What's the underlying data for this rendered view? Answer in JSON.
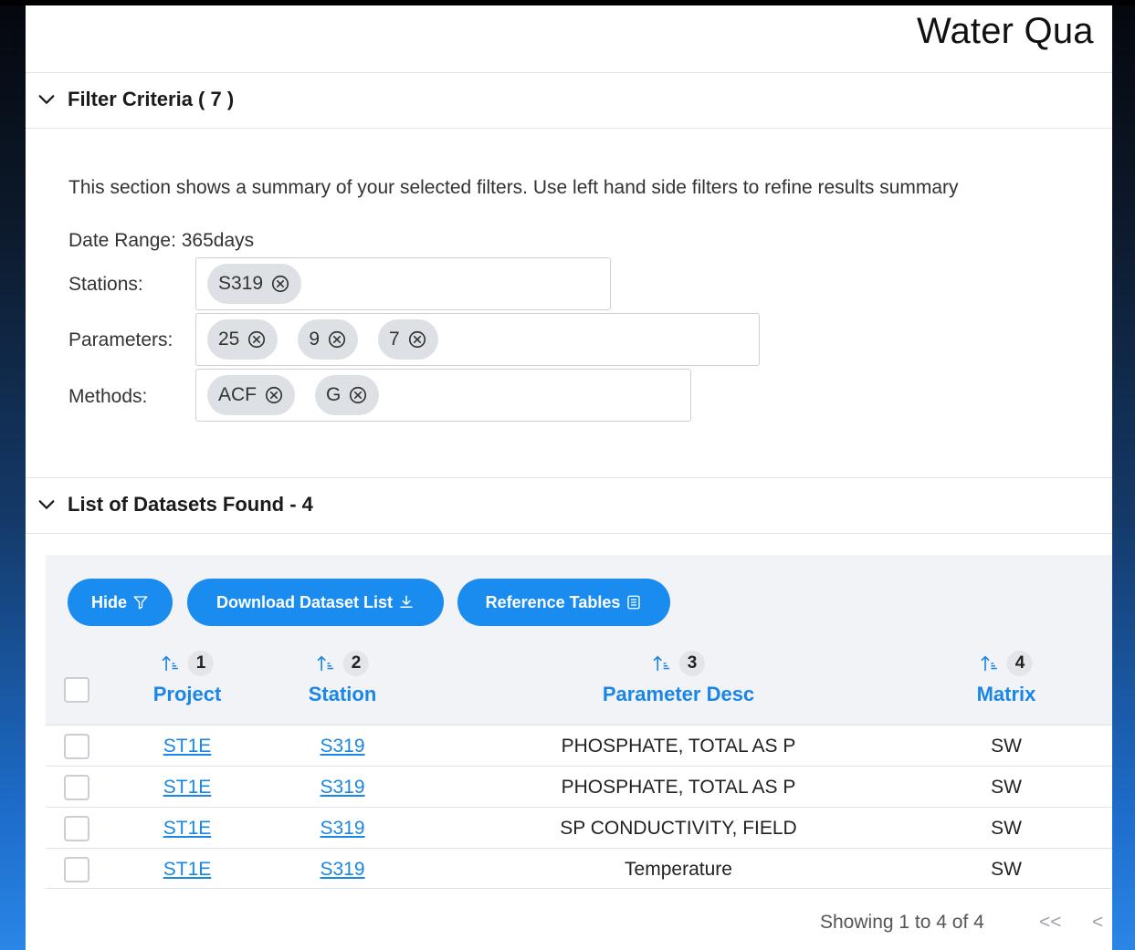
{
  "page": {
    "title": "Water Qua"
  },
  "filter_section": {
    "title": "Filter Criteria ( 7 )",
    "summary_text": "This section shows a summary of your selected filters. Use left hand side filters to refine results summary",
    "date_range": "Date Range: 365days",
    "stations": {
      "label": "Stations:",
      "chips": [
        "S319"
      ]
    },
    "parameters": {
      "label": "Parameters:",
      "chips": [
        "25",
        "9",
        "7"
      ]
    },
    "methods": {
      "label": "Methods:",
      "chips": [
        "ACF",
        "G"
      ]
    }
  },
  "datasets_section": {
    "title": "List of Datasets Found - 4",
    "buttons": {
      "hide": "Hide",
      "download": "Download Dataset List",
      "reference": "Reference Tables"
    },
    "columns": [
      {
        "order": "1",
        "label": "Project"
      },
      {
        "order": "2",
        "label": "Station"
      },
      {
        "order": "3",
        "label": "Parameter Desc"
      },
      {
        "order": "4",
        "label": "Matrix"
      }
    ],
    "rows": [
      {
        "project": "ST1E",
        "station": "S319",
        "parameter": "PHOSPHATE, TOTAL AS P",
        "matrix": "SW"
      },
      {
        "project": "ST1E",
        "station": "S319",
        "parameter": "PHOSPHATE, TOTAL AS P",
        "matrix": "SW"
      },
      {
        "project": "ST1E",
        "station": "S319",
        "parameter": "SP CONDUCTIVITY, FIELD",
        "matrix": "SW"
      },
      {
        "project": "ST1E",
        "station": "S319",
        "parameter": "Temperature",
        "matrix": "SW"
      }
    ],
    "pagination": {
      "text": "Showing 1 to 4 of 4",
      "first": "<<",
      "prev": "<"
    }
  },
  "colors": {
    "accent": "#1a8cf0",
    "link": "#1a86e6",
    "chip_bg": "#dde1e6"
  }
}
